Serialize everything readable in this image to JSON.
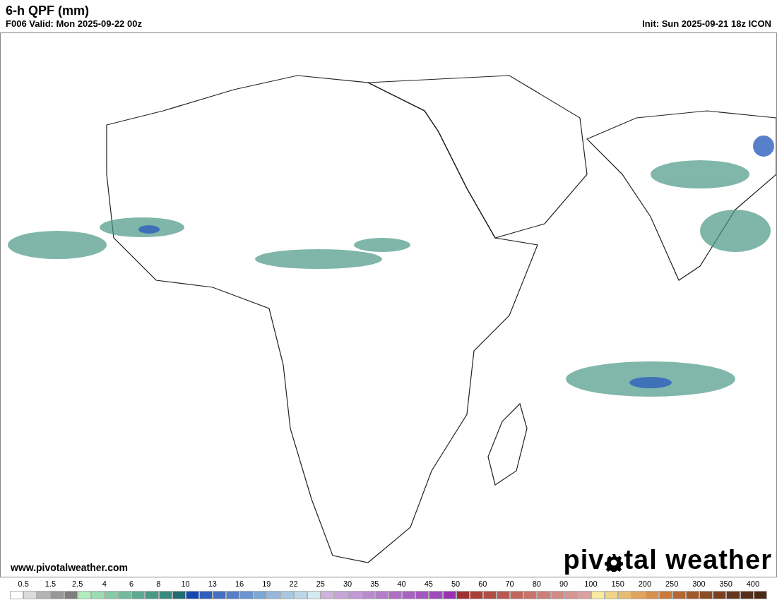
{
  "header": {
    "title": "6-h QPF (mm)",
    "valid": "F006 Valid: Mon 2025-09-22 00z",
    "init": "Init: Sun 2025-09-21 18z ICON"
  },
  "map": {
    "website": "www.pivotalweather.com",
    "logo_before": "piv",
    "logo_after": "tal weather"
  },
  "legend": {
    "labels": [
      "0.5",
      "1.5",
      "2.5",
      "4",
      "6",
      "8",
      "10",
      "13",
      "16",
      "19",
      "22",
      "25",
      "30",
      "35",
      "40",
      "45",
      "50",
      "60",
      "70",
      "80",
      "90",
      "100",
      "150",
      "200",
      "250",
      "300",
      "350",
      "400"
    ],
    "swatches": [
      {
        "color": "#ffffff"
      },
      {
        "color": "#dadada"
      },
      {
        "color": "#b4b4b4"
      },
      {
        "color": "#989898"
      },
      {
        "color": "#7e7e7e"
      },
      {
        "color": "#b1ecbc"
      },
      {
        "color": "#9bdcb0"
      },
      {
        "color": "#87cba6"
      },
      {
        "color": "#72bb9b"
      },
      {
        "color": "#5ea991"
      },
      {
        "color": "#4a9886"
      },
      {
        "color": "#358b7e"
      },
      {
        "color": "#1f6b73"
      },
      {
        "color": "#1447b0"
      },
      {
        "color": "#2e5fbd"
      },
      {
        "color": "#4470c4"
      },
      {
        "color": "#5580c8"
      },
      {
        "color": "#6a94ce"
      },
      {
        "color": "#7ea6d4"
      },
      {
        "color": "#95b8dc"
      },
      {
        "color": "#a8c8e2"
      },
      {
        "color": "#bcd8e8"
      },
      {
        "color": "#d2eaf0"
      },
      {
        "color": "#ccb4dc"
      },
      {
        "color": "#c6a6d8"
      },
      {
        "color": "#c098d4"
      },
      {
        "color": "#ba8acf"
      },
      {
        "color": "#b47cca"
      },
      {
        "color": "#ae6ec6"
      },
      {
        "color": "#a862c2"
      },
      {
        "color": "#a456c0"
      },
      {
        "color": "#a04abd"
      },
      {
        "color": "#9b30b4"
      },
      {
        "color": "#a03030"
      },
      {
        "color": "#a84038"
      },
      {
        "color": "#b04c44"
      },
      {
        "color": "#b85a50"
      },
      {
        "color": "#c0665e"
      },
      {
        "color": "#c8726a"
      },
      {
        "color": "#cc7e78"
      },
      {
        "color": "#d48a84"
      },
      {
        "color": "#d89490"
      },
      {
        "color": "#dca0a0"
      },
      {
        "color": "#f8eaa0"
      },
      {
        "color": "#f0d488"
      },
      {
        "color": "#e8bc70"
      },
      {
        "color": "#e0a45e"
      },
      {
        "color": "#d8904c"
      },
      {
        "color": "#cc7838"
      },
      {
        "color": "#b46830"
      },
      {
        "color": "#a05a28"
      },
      {
        "color": "#8c4c24"
      },
      {
        "color": "#7a4020"
      },
      {
        "color": "#68361c"
      },
      {
        "color": "#56301a"
      },
      {
        "color": "#4a2a16"
      }
    ]
  }
}
